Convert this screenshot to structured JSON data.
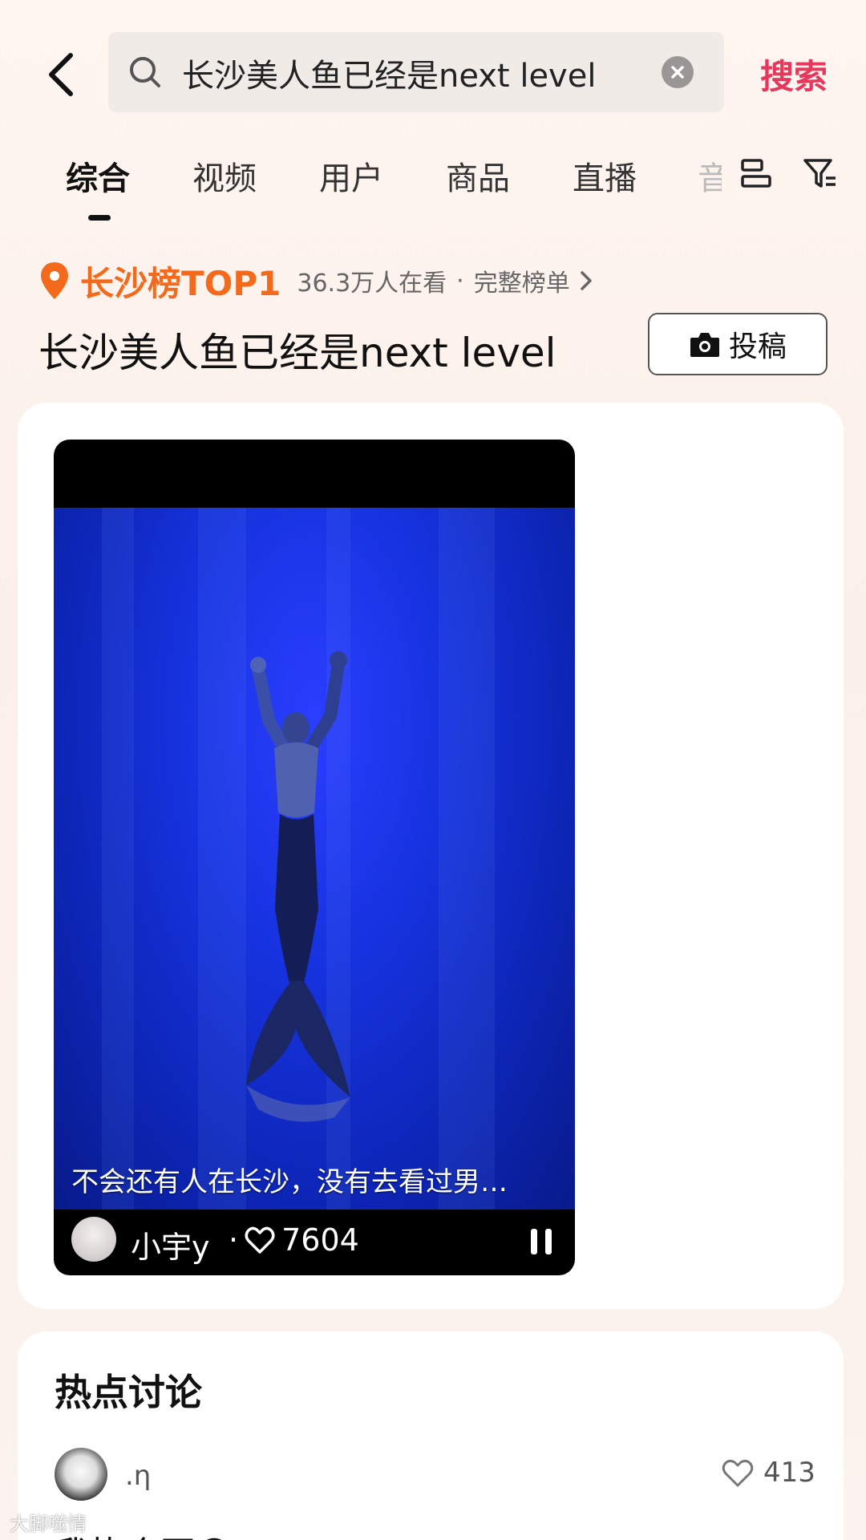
{
  "header": {
    "search_query": "长沙美人鱼已经是next level",
    "search_action": "搜索"
  },
  "tabs": [
    {
      "label": "综合",
      "active": true
    },
    {
      "label": "视频"
    },
    {
      "label": "用户"
    },
    {
      "label": "商品"
    },
    {
      "label": "直播"
    },
    {
      "label": "音"
    }
  ],
  "topic": {
    "rank_label": "长沙榜TOP1",
    "viewers": "36.3万人在看",
    "separator": "·",
    "full_list": "完整榜单",
    "title": "长沙美人鱼已经是next level",
    "submit_label": "投稿"
  },
  "video": {
    "caption": "不会还有人在长沙，没有去看过男…",
    "author": "小宇y",
    "separator": "·",
    "likes": "7604"
  },
  "discussion": {
    "title": "热点讨论",
    "comment": {
      "user": ".η",
      "likes": "413",
      "text": "我执个豆😳"
    }
  },
  "watermark": "大脚噬情",
  "colors": {
    "accent": "#e5385c",
    "rank_orange": "#f36a1d",
    "water_blue": "#1733e0"
  },
  "icons": [
    "back-arrow-icon",
    "search-icon",
    "clear-icon",
    "layout-icon",
    "filter-icon",
    "location-pin-icon",
    "chevron-right-icon",
    "camera-icon",
    "heart-icon",
    "pause-icon"
  ]
}
